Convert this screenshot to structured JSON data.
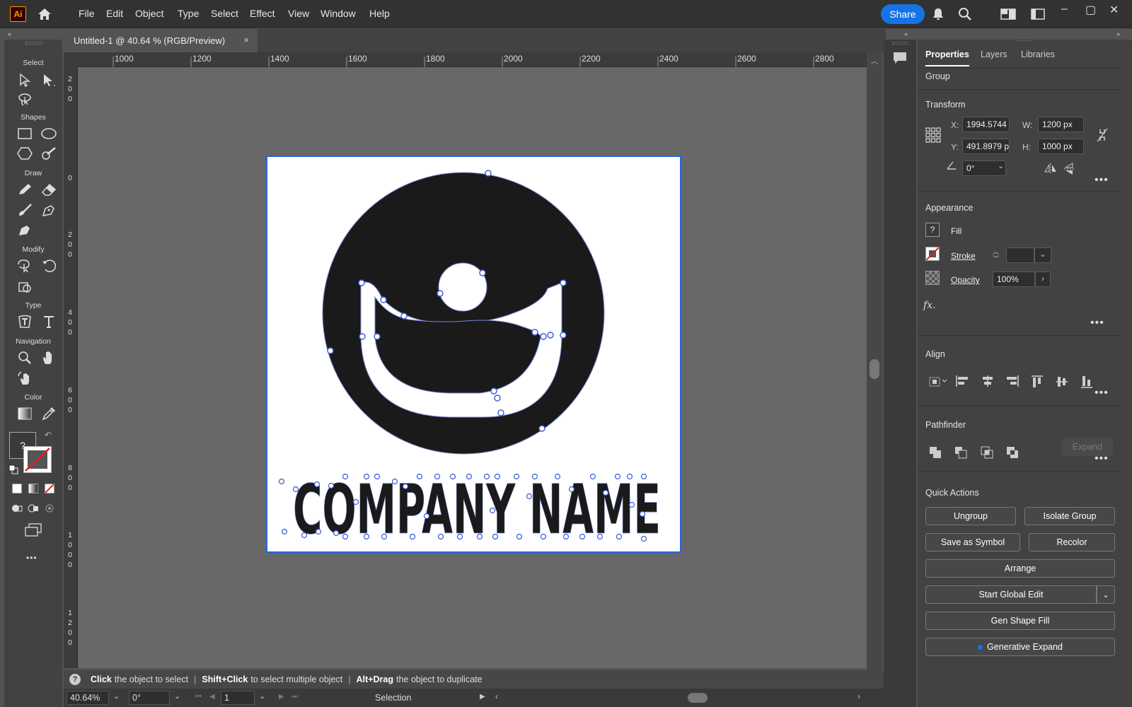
{
  "app": {
    "logo_text": "Ai"
  },
  "menu": [
    "File",
    "Edit",
    "Object",
    "Type",
    "Select",
    "Effect",
    "View",
    "Window",
    "Help"
  ],
  "share_label": "Share",
  "document_tab": {
    "title": "Untitled-1 @ 40.64 % (RGB/Preview)",
    "close_glyph": "×"
  },
  "toolbar": {
    "groups": {
      "select": "Select",
      "shapes": "Shapes",
      "draw": "Draw",
      "modify": "Modify",
      "type": "Type",
      "navigation": "Navigation",
      "color": "Color"
    },
    "fill_unknown_glyph": "?",
    "more_glyph": "•••"
  },
  "ruler": {
    "h_ticks": [
      "1000",
      "1200",
      "1400",
      "1600",
      "1800",
      "2000",
      "2200",
      "2400",
      "2600",
      "2800"
    ],
    "v_ticks": [
      "200",
      "0",
      "200",
      "400",
      "600",
      "800",
      "1000",
      "1200"
    ]
  },
  "artwork": {
    "company_text": "COMPANY NAME"
  },
  "hint": {
    "a_bold": "Click",
    "a_text": "the object to select",
    "b_bold": "Shift+Click",
    "b_text": "to select multiple object",
    "c_bold": "Alt+Drag",
    "c_text": "the object to duplicate",
    "help_glyph": "?"
  },
  "status": {
    "zoom": "40.64%",
    "rotation": "0°",
    "artboard": "1",
    "tool": "Selection"
  },
  "panel": {
    "tabs": [
      "Properties",
      "Layers",
      "Libraries"
    ],
    "selection_type": "Group",
    "transform": {
      "title": "Transform",
      "x_label": "X:",
      "x": "1994.5744",
      "y_label": "Y:",
      "y": "491.8979 p",
      "w_label": "W:",
      "w": "1200 px",
      "h_label": "H:",
      "h": "1000 px",
      "angle": "0°"
    },
    "appearance": {
      "title": "Appearance",
      "fill_label": "Fill",
      "fill_glyph": "?",
      "stroke_label": "Stroke",
      "opacity_label": "Opacity",
      "opacity": "100%",
      "fx_label": "fx."
    },
    "align": {
      "title": "Align"
    },
    "pathfinder": {
      "title": "Pathfinder",
      "expand_label": "Expand"
    },
    "quick_actions": {
      "title": "Quick Actions",
      "ungroup": "Ungroup",
      "isolate_group": "Isolate Group",
      "save_as_symbol": "Save as Symbol",
      "recolor": "Recolor",
      "arrange": "Arrange",
      "start_global_edit": "Start Global Edit",
      "gen_shape_fill": "Gen Shape Fill",
      "generative_expand": "Generative Expand"
    },
    "more_glyph": "•••"
  },
  "colors": {
    "accent": "#1473e6",
    "selection": "#2d62e0",
    "logo_fill": "#1a1a1a"
  }
}
